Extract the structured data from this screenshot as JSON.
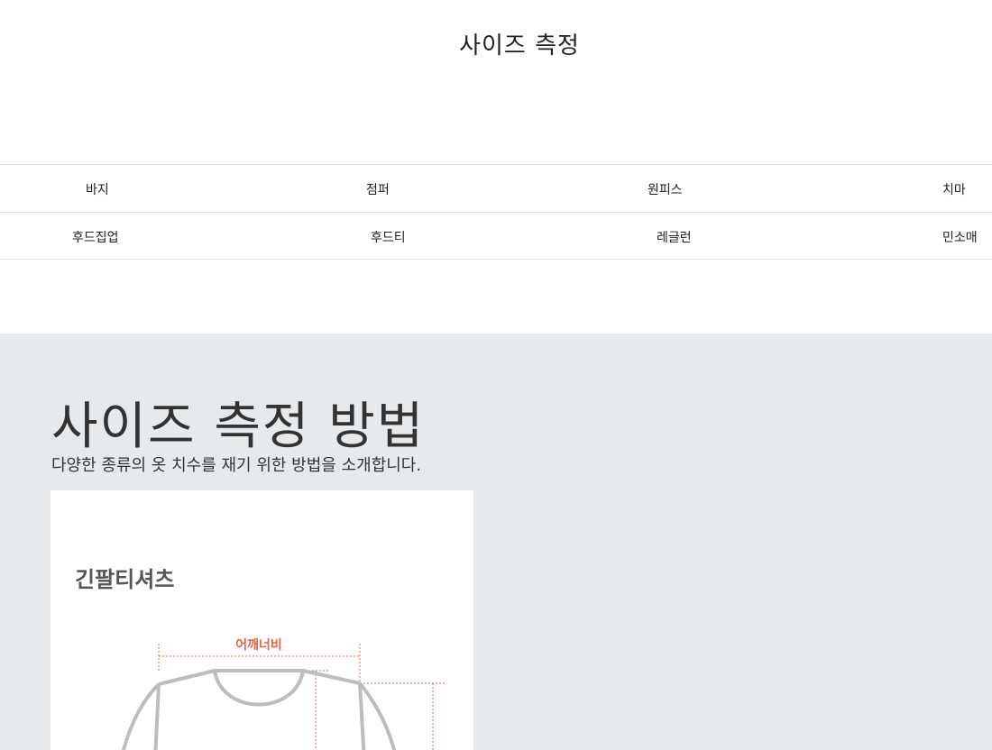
{
  "header": {
    "title": "사이즈 측정"
  },
  "categories": {
    "row1": [
      "바지",
      "점퍼",
      "원피스",
      "치마"
    ],
    "row2": [
      "후드집업",
      "후드티",
      "레글런",
      "민소매"
    ]
  },
  "guide": {
    "heading": "사이즈 측정 방법",
    "description": "다양한 종류의 옷 치수를 재기 위한 방법을 소개합니다.",
    "card": {
      "name": "긴팔티셔츠",
      "measure_label": "어깨너비",
      "colors": {
        "measure": "#e0664a",
        "outline": "#bdbdbd"
      }
    }
  }
}
